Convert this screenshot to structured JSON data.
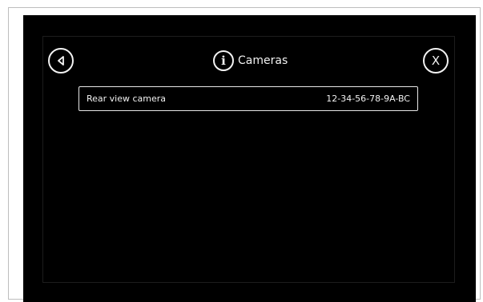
{
  "header": {
    "title": "Cameras",
    "info_icon": "i",
    "close_label": "X",
    "icons": {
      "back": "back-arrow-icon",
      "info": "info-icon",
      "close": "close-icon"
    }
  },
  "cameras": [
    {
      "name": "Rear view camera",
      "address": "12-34-56-78-9A-BC"
    }
  ],
  "colors": {
    "screen_background": "#000000",
    "foreground": "#f2f2f2"
  }
}
